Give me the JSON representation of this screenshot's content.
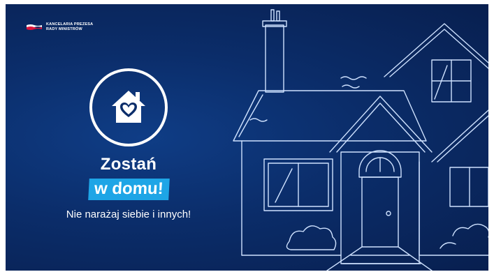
{
  "logo": {
    "line1": "KANCELARIA PREZESA",
    "line2": "RADY MINISTRÓW",
    "icon": "polish-flag-icon",
    "flag_colors": [
      "#ffffff",
      "#dc143c"
    ]
  },
  "badge": {
    "icon": "house-heart-icon"
  },
  "headline": {
    "title": "Zostań",
    "highlight": "w domu!",
    "subtitle": "Nie narażaj siebie i innych!"
  },
  "illustration": {
    "icon": "house-sketch-illustration"
  },
  "colors": {
    "background": "#0b2d6a",
    "accent": "#1ea5e6",
    "text": "#ffffff",
    "sketch": "#cfe2ff"
  }
}
